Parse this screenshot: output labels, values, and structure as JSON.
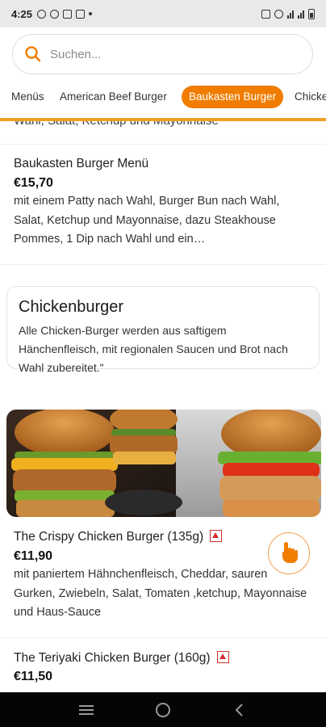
{
  "status_bar": {
    "time": "4:25"
  },
  "search": {
    "placeholder": "Suchen..."
  },
  "tabs": [
    {
      "label": "Menüs"
    },
    {
      "label": "American Beef Burger"
    },
    {
      "label": "Baukasten Burger",
      "active": true
    },
    {
      "label": "Chicke"
    }
  ],
  "clipped_text": "Wahl, Salat, Ketchup und Mayonnaise",
  "products_top": [
    {
      "title": "Baukasten Burger Menü",
      "price": "€15,70",
      "description": "mit einem Patty nach Wahl, Burger Bun nach Wahl, Salat, Ketchup und Mayonnaise, dazu Steakhouse Pommes, 1 Dip nach Wahl und ein…"
    }
  ],
  "category": {
    "title": "Chickenburger",
    "description": "Alle Chicken-Burger werden aus saftigem Hänchenfleisch, mit regionalen Saucen und Brot nach Wahl zubereitet.\""
  },
  "products": [
    {
      "title": "The Crispy Chicken Burger (135g)",
      "price": "€11,90",
      "description": "mit paniertem Hähnchenfleisch, Cheddar, sauren Gurken, Zwiebeln, Salat, Tomaten ,ketchup, Mayonnaise und Haus-Sauce"
    },
    {
      "title": "The Teriyaki Chicken Burger (160g)",
      "price": "€11,50"
    }
  ],
  "colors": {
    "accent": "#f07d00",
    "underline": "#f0a020",
    "alert": "#d03030"
  },
  "icons": {
    "search": "search-icon",
    "fab": "hand-pointer-icon",
    "alert": "allergen-warning-icon"
  }
}
